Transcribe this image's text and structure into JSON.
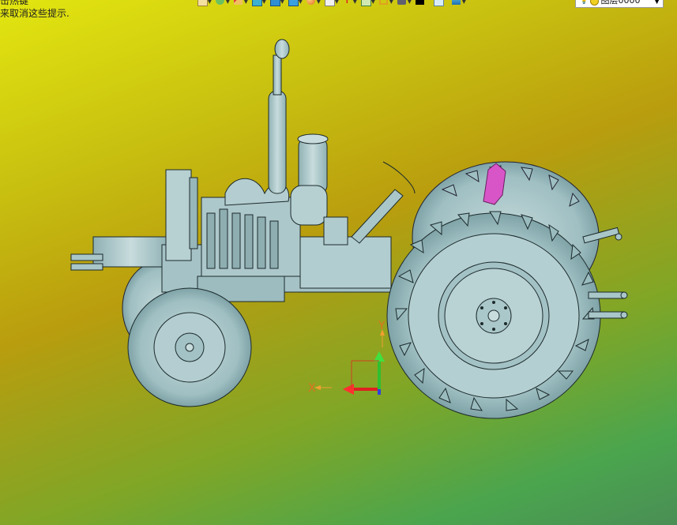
{
  "app": {
    "hint_line1": "击热键",
    "hint_line2": "来取消这些提示."
  },
  "toolbar": {
    "icons": [
      "new-file-icon",
      "layers-icon",
      "pencil-icon",
      "solid-box-icon",
      "cube-view-icon",
      "shaded-view-icon",
      "render-sphere-icon",
      "document-icon",
      "snap-point-icon",
      "sheet-icon",
      "frame-icon",
      "display-icon",
      "color-swatch-icon",
      "paper-icon",
      "layer-stack-icon"
    ]
  },
  "layer_selector": {
    "label": "图层0000"
  },
  "viewport": {
    "model": "tractor-3d-model",
    "axis_x_label": "X",
    "axis_y_label": "Y",
    "background_colors": [
      "#e3e610",
      "#b99d0e",
      "#4aa54e"
    ],
    "model_color": "#a8c8ca",
    "highlight_color": "#d855c8"
  }
}
